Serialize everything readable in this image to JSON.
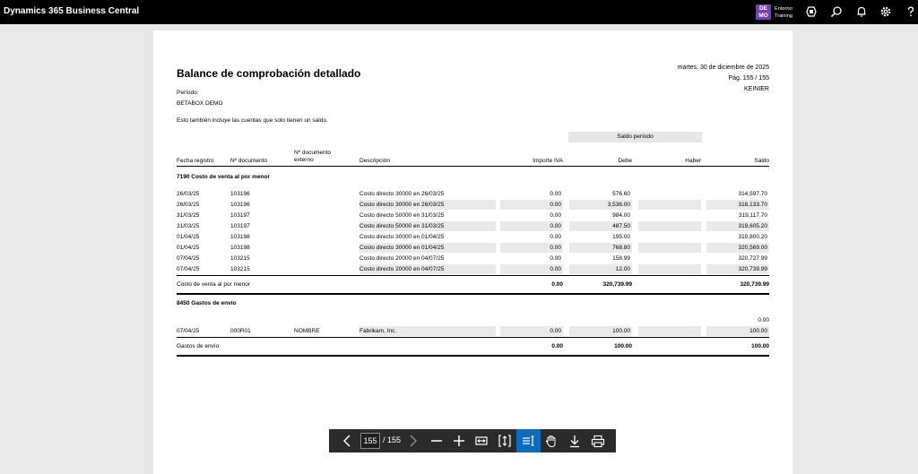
{
  "app": {
    "title": "Dynamics 365 Business Central",
    "env_badge_line1": "DE",
    "env_badge_line2": "MO",
    "env_label": "Entorno:",
    "env_name": "Training",
    "icons": [
      "copilot-icon",
      "search-icon",
      "bell-icon",
      "gear-icon",
      "help-icon"
    ]
  },
  "report": {
    "title": "Balance de comprobación detallado",
    "date": "martes, 30 de diciembre de 2025",
    "page": "Pág. 155 / 155",
    "user": "KEINIER",
    "period_label": "Período:",
    "company": "BETABOX DEMO",
    "note": "Esto también incluye las cuentas que solo tienen un saldo.",
    "saldo_header": "Saldo período",
    "columns": {
      "fecha": "Fecha registro",
      "doc": "Nº documento",
      "doc_ext_1": "Nº documento",
      "doc_ext_2": "externo",
      "desc": "Descripción",
      "iva": "Importe IVA",
      "debe": "Debe",
      "haber": "Haber",
      "saldo": "Saldo"
    },
    "sections": [
      {
        "heading": "7190 Costo de venta al por menor",
        "rows": [
          {
            "fecha": "26/03/25",
            "doc": "103196",
            "ext": "",
            "desc": "Costo directo 30000 en 26/03/25",
            "iva": "0.00",
            "debe": "576.60",
            "haber": "",
            "saldo": "314,597.70"
          },
          {
            "fecha": "26/03/25",
            "doc": "103196",
            "ext": "",
            "desc": "Costo directo 30000 en 26/03/25",
            "iva": "0.00",
            "debe": "3,536.00",
            "haber": "",
            "saldo": "318,133.70"
          },
          {
            "fecha": "31/03/25",
            "doc": "103197",
            "ext": "",
            "desc": "Costo directo 50000 en 31/03/25",
            "iva": "0.00",
            "debe": "984.00",
            "haber": "",
            "saldo": "319,117.70"
          },
          {
            "fecha": "31/03/25",
            "doc": "103197",
            "ext": "",
            "desc": "Costo directo 50000 en 31/03/25",
            "iva": "0.00",
            "debe": "487.50",
            "haber": "",
            "saldo": "319,605.20"
          },
          {
            "fecha": "01/04/25",
            "doc": "103198",
            "ext": "",
            "desc": "Costo directo 30000 en 01/04/25",
            "iva": "0.00",
            "debe": "195.00",
            "haber": "",
            "saldo": "319,800.20"
          },
          {
            "fecha": "01/04/25",
            "doc": "103198",
            "ext": "",
            "desc": "Costo directo 30000 en 01/04/25",
            "iva": "0.00",
            "debe": "768.80",
            "haber": "",
            "saldo": "320,569.00"
          },
          {
            "fecha": "07/04/25",
            "doc": "103215",
            "ext": "",
            "desc": "Costo directo 20000 en 04/07/25",
            "iva": "0.00",
            "debe": "158.99",
            "haber": "",
            "saldo": "320,727.99"
          },
          {
            "fecha": "07/04/25",
            "doc": "103215",
            "ext": "",
            "desc": "Costo directo 20000 en 04/07/25",
            "iva": "0.00",
            "debe": "12.00",
            "haber": "",
            "saldo": "320,739.99"
          }
        ],
        "total": {
          "label": "Costo de venta al por menor",
          "iva": "0.00",
          "debe": "320,739.99",
          "haber": "",
          "saldo": "320,739.99"
        }
      },
      {
        "heading": "8450 Gastos de envío",
        "opening": "0.00",
        "rows": [
          {
            "fecha": "07/04/25",
            "doc": "000R01",
            "ext": "NOMBRE",
            "desc": "Fabrikam, Inc.",
            "iva": "0.00",
            "debe": "100.00",
            "haber": "",
            "saldo": "100.00"
          }
        ],
        "total": {
          "label": "Gastos de envío",
          "iva": "0.00",
          "debe": "100.00",
          "haber": "",
          "saldo": "100.00"
        }
      }
    ]
  },
  "viewer": {
    "current_page": "155",
    "total_pages": "/ 155",
    "tools": [
      "prev-page",
      "next-page",
      "zoom-out",
      "zoom-in",
      "fit-width",
      "fit-page",
      "text-select",
      "hand-tool",
      "download",
      "print"
    ],
    "active_tool": "text-select"
  }
}
